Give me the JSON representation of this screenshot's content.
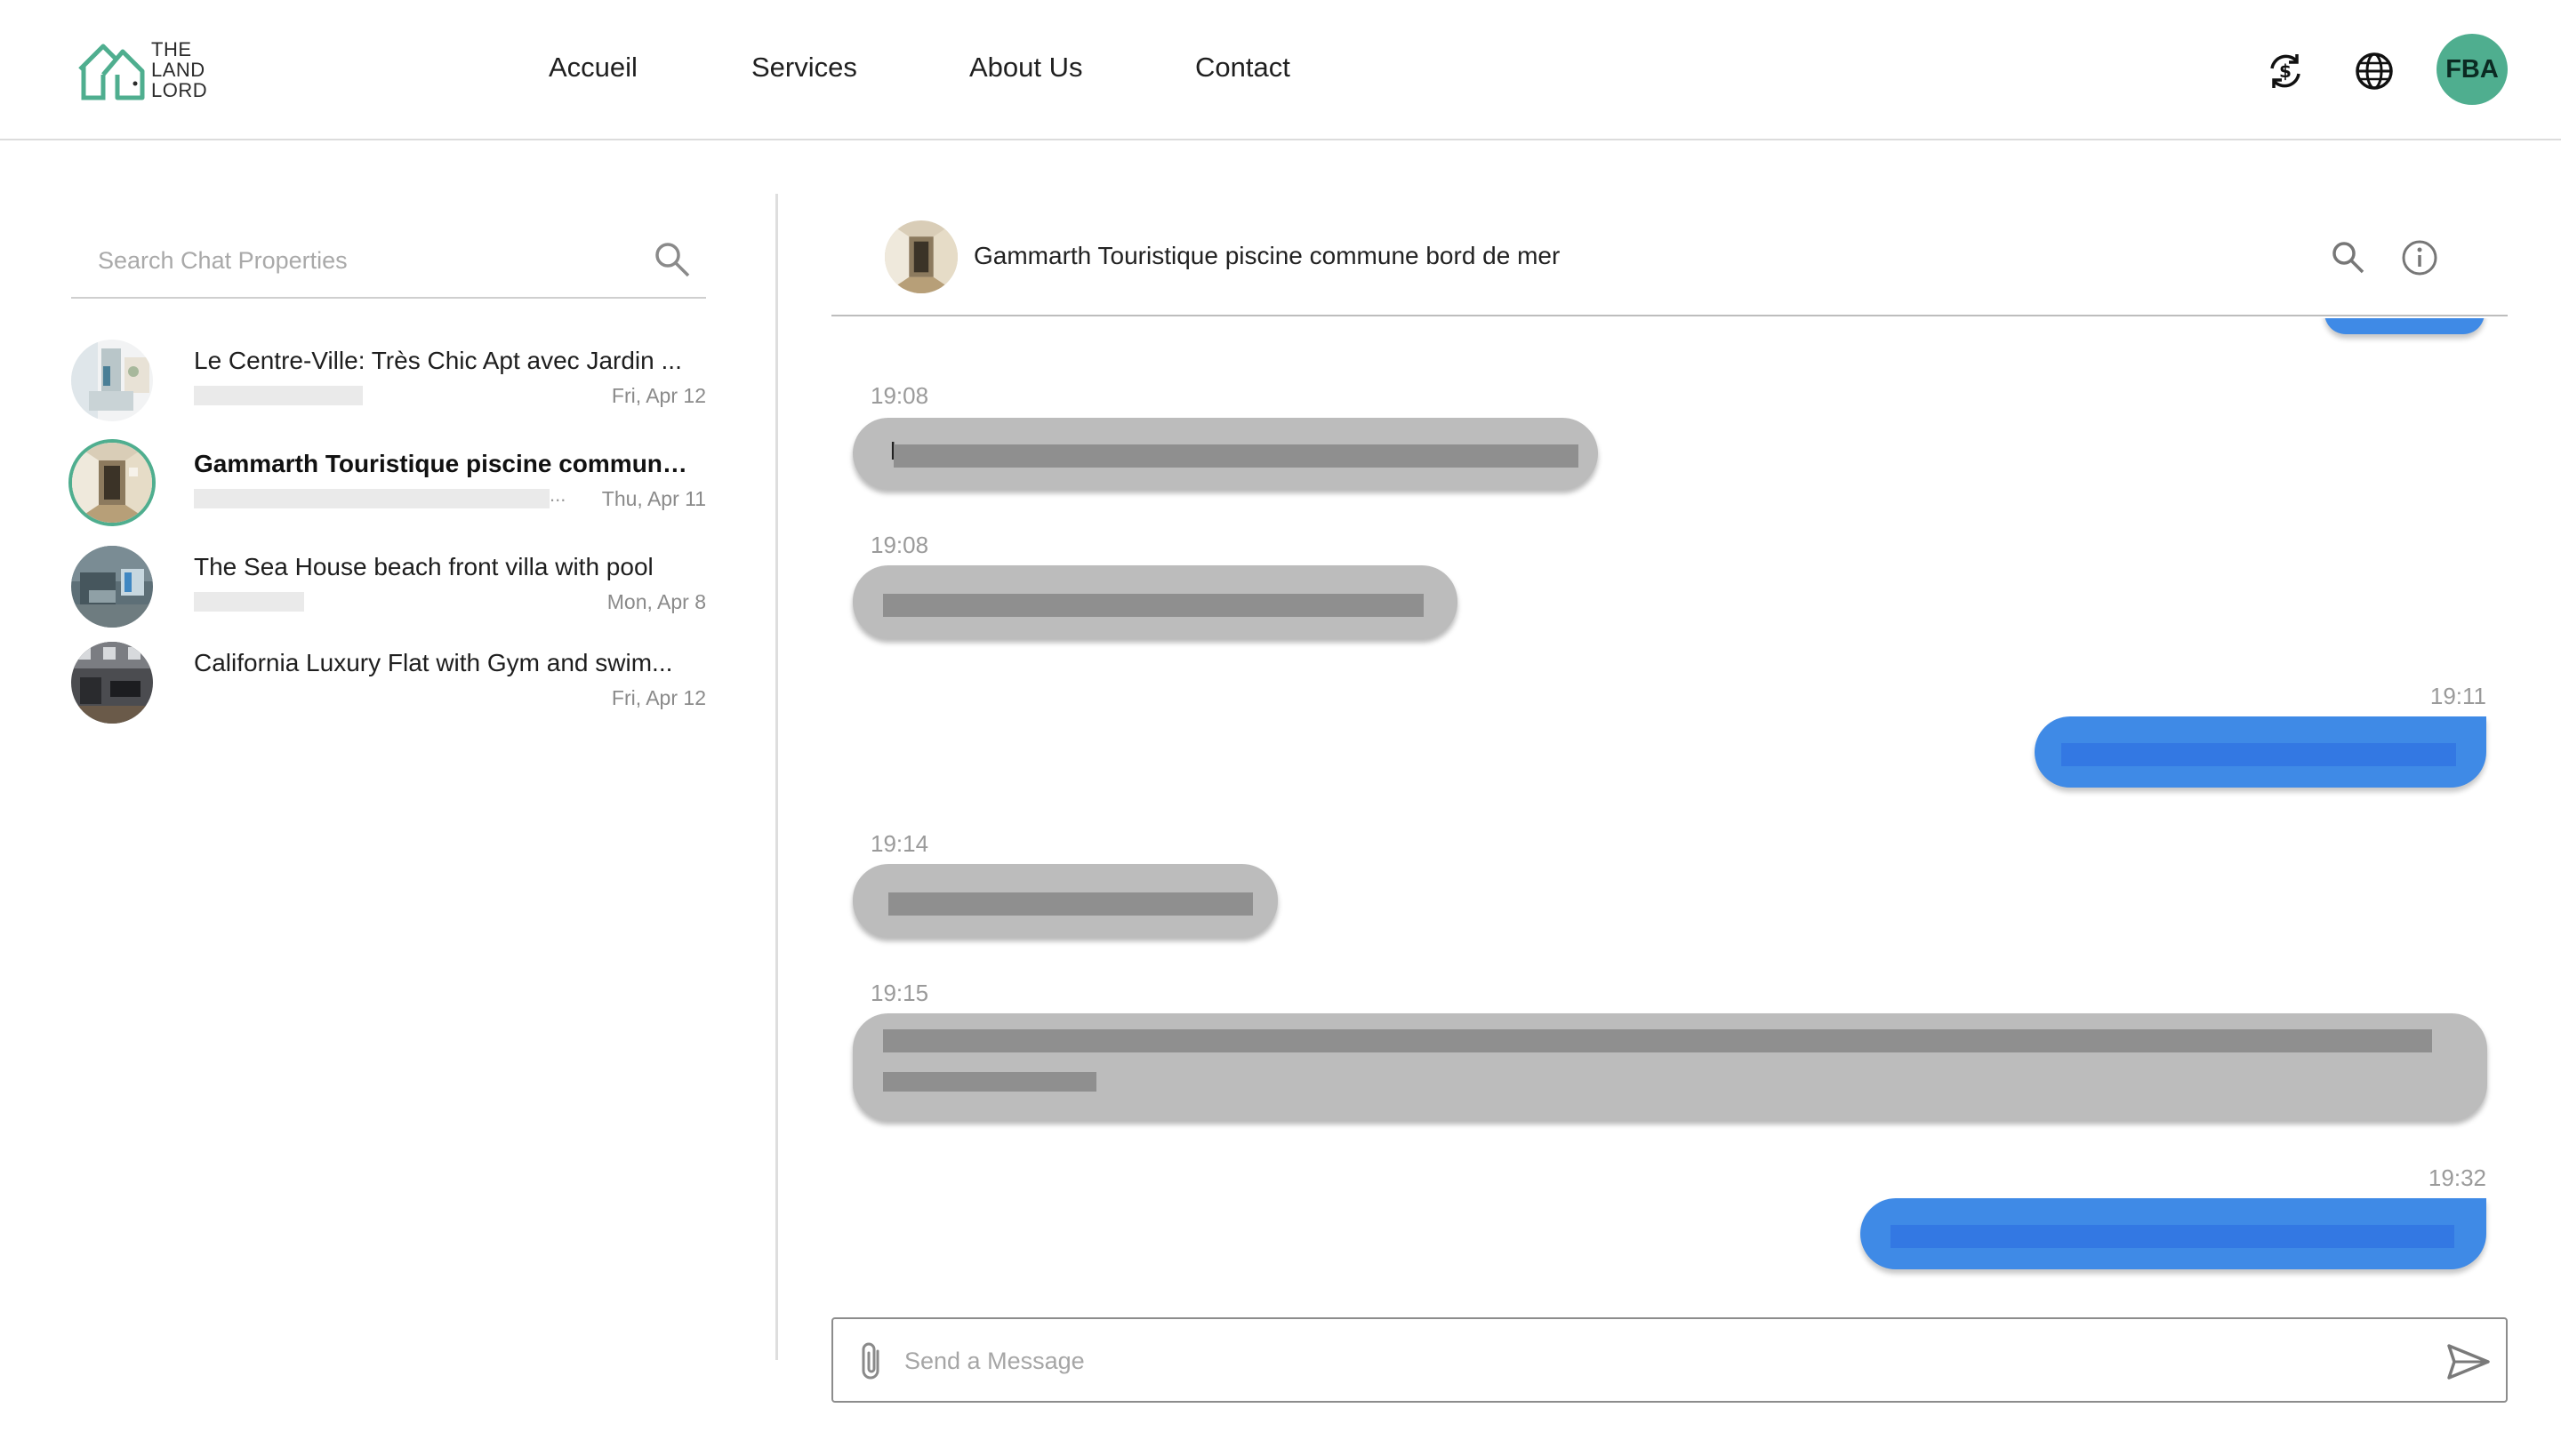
{
  "brand": {
    "logo_lines": [
      "THE",
      "LAND",
      "LORD"
    ],
    "accent": "#4fae8f"
  },
  "nav": {
    "items": [
      {
        "label": "Accueil"
      },
      {
        "label": "Services"
      },
      {
        "label": "About Us"
      },
      {
        "label": "Contact"
      }
    ]
  },
  "header_icons": [
    "currency-exchange-icon",
    "globe-icon"
  ],
  "user": {
    "initials": "FBA",
    "avatar_color": "#4fae8f"
  },
  "sidebar": {
    "search_placeholder": "Search Chat Properties",
    "conversations": [
      {
        "title": "Le Centre-Ville: Très Chic Apt avec Jardin ...",
        "date": "Fri, Apr 12",
        "active": false
      },
      {
        "title": "Gammarth Touristique piscine commune b...",
        "date": "Thu, Apr 11",
        "active": true,
        "preview_suffix": "..."
      },
      {
        "title": "The Sea House beach front villa with pool",
        "date": "Mon, Apr 8",
        "active": false
      },
      {
        "title": "California Luxury Flat with Gym and swim...",
        "date": "Fri, Apr 12",
        "active": false
      }
    ]
  },
  "chat": {
    "title": "Gammarth Touristique piscine commune bord de mer",
    "messages": [
      {
        "time": "19:08",
        "direction": "in",
        "lead_char": "h"
      },
      {
        "time": "19:08",
        "direction": "in"
      },
      {
        "time": "19:11",
        "direction": "out"
      },
      {
        "time": "19:14",
        "direction": "in"
      },
      {
        "time": "19:15",
        "direction": "in"
      },
      {
        "time": "19:32",
        "direction": "out"
      }
    ],
    "bubble_in_color": "#bcbcbc",
    "bubble_out_color": "#3f8ae6",
    "composer_placeholder": "Send a Message"
  }
}
